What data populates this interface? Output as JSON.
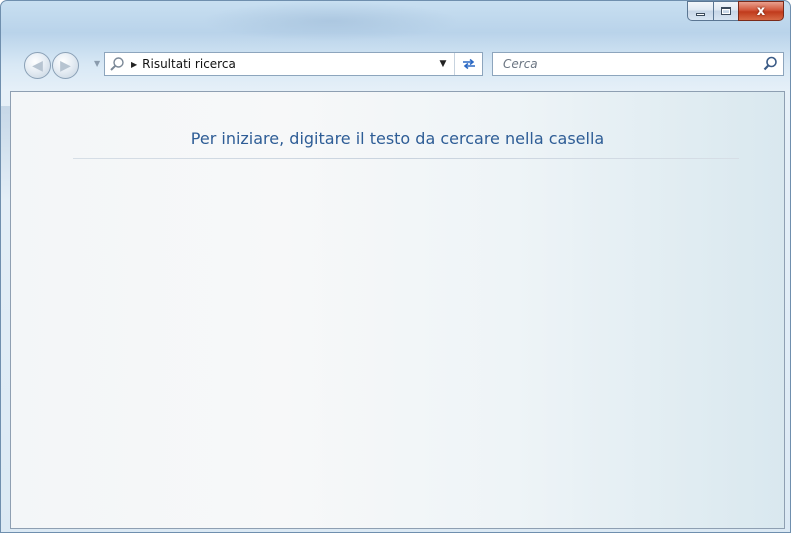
{
  "window": {
    "caption": {
      "minimize_icon": "minimize-icon",
      "maximize_icon": "maximize-icon",
      "close_label": "x"
    }
  },
  "toolbar": {
    "back_icon": "back-arrow-icon",
    "forward_icon": "forward-arrow-icon",
    "address": {
      "icon": "search-icon",
      "breadcrumb": "Risultati ricerca"
    },
    "refresh_icon": "refresh-icon"
  },
  "search": {
    "placeholder": "Cerca",
    "value": "",
    "icon": "search-icon"
  },
  "content": {
    "hint": "Per iniziare, digitare il testo da cercare nella casella"
  },
  "colors": {
    "hint_text": "#2e5d96",
    "refresh_accent": "#2c69c4",
    "close_button": "#c03a1c"
  }
}
